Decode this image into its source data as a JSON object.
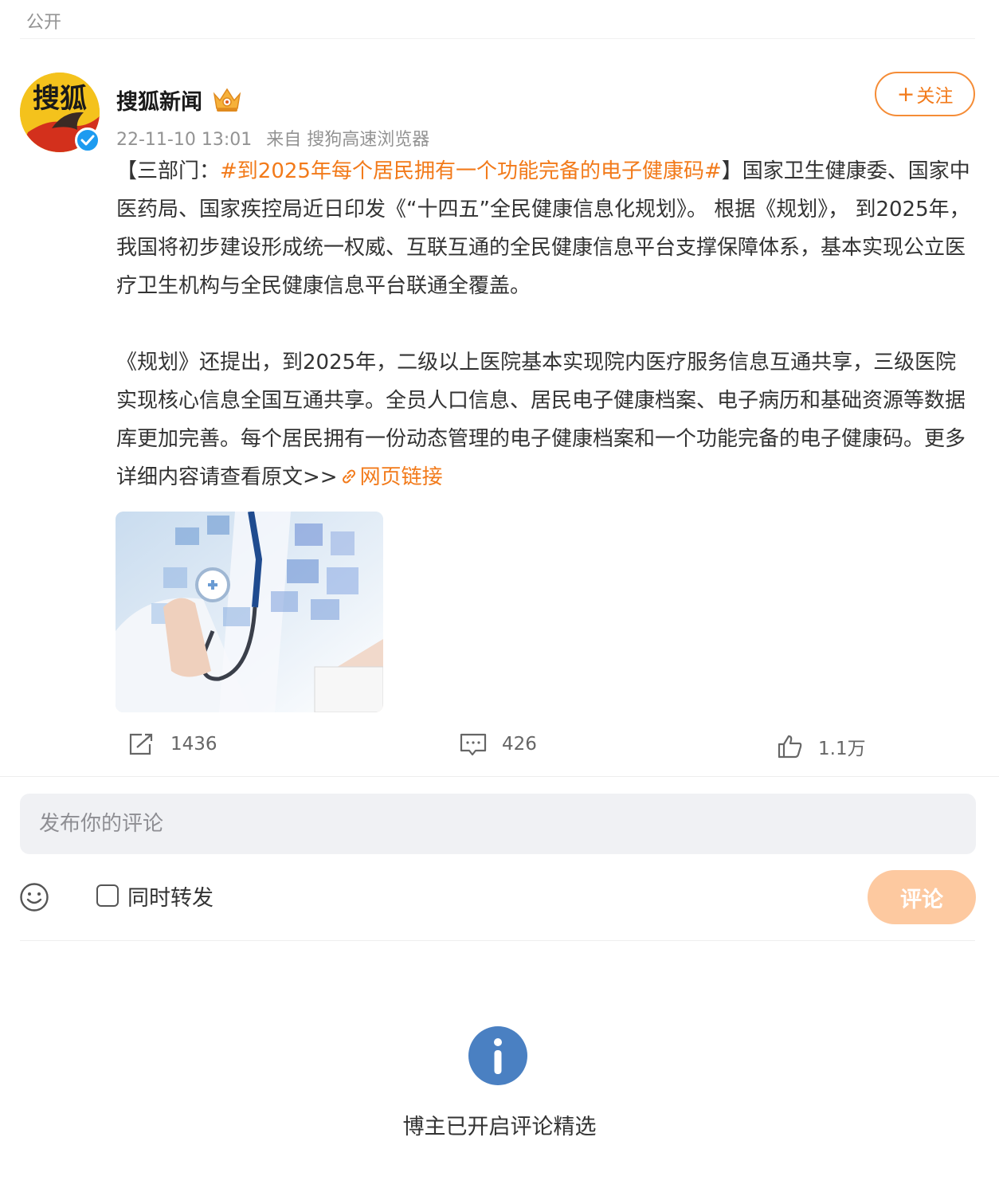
{
  "header": {
    "visibility": "公开"
  },
  "author": {
    "name": "搜狐新闻",
    "avatar_text": "搜狐",
    "crown_icon": "crown-icon",
    "verified_icon": "verified-icon"
  },
  "meta": {
    "time": "22-11-10 13:01",
    "source": "来自 搜狗高速浏览器"
  },
  "follow": {
    "plus": "+",
    "label": "关注"
  },
  "post": {
    "p1_prefix": "【三部门：",
    "hashtag": "#到2025年每个居民拥有一个功能完备的电子健康码#",
    "p1_rest": "】国家卫生健康委、国家中医药局、国家疾控局近日印发《“十四五”全民健康信息化规划》。 根据《规划》， 到2025年，我国将初步建设形成统一权威、互联互通的全民健康信息平台支撑保障体系，基本实现公立医疗卫生机构与全民健康信息平台联通全覆盖。",
    "p2_text": "《规划》还提出，到2025年，二级以上医院基本实现院内医疗服务信息互通共享，三级医院实现核心信息全国互通共享。全员人口信息、居民电子健康档案、电子病历和基础资源等数据库更加完善。每个居民拥有一份动态管理的电子健康档案和一个功能完备的电子健康码。更多详细内容请查看原文>>",
    "link_label": "网页链接"
  },
  "actions": {
    "repost_count": "1436",
    "comment_count": "426",
    "like_count": "1.1万"
  },
  "composer": {
    "placeholder": "发布你的评论",
    "repost_label": "同时转发",
    "submit_label": "评论"
  },
  "notice": {
    "text": "博主已开启评论精选"
  },
  "colors": {
    "accent": "#f27a1a",
    "submit_disabled": "#fdc9a0",
    "info_blue": "#4a80c2"
  }
}
